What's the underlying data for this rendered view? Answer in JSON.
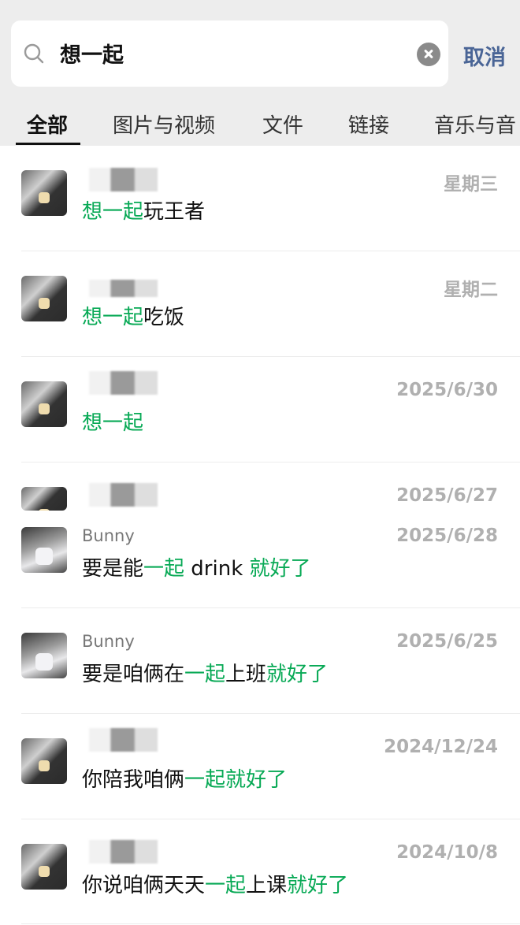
{
  "search": {
    "query": "想一起",
    "cancel_label": "取消"
  },
  "tabs": [
    {
      "label": "全部"
    },
    {
      "label": "图片与视频"
    },
    {
      "label": "文件"
    },
    {
      "label": "链接"
    },
    {
      "label": "音乐与音"
    }
  ],
  "colors": {
    "highlight": "#07a955",
    "cancel": "#4a6596",
    "date": "#b0b0b0"
  },
  "results": [
    {
      "date": "星期三",
      "parts": [
        "想一起",
        "玩王者"
      ]
    },
    {
      "date": "星期二",
      "parts": [
        "想一起",
        "吃饭"
      ]
    },
    {
      "date": "2025/6/30",
      "parts": [
        "想一起"
      ]
    },
    {
      "date": "2025/6/27"
    },
    {
      "name": "Bunny",
      "date": "2025/6/28",
      "parts": [
        "要是能",
        "一起",
        " drink ",
        "就好了"
      ]
    },
    {
      "name": "Bunny",
      "date": "2025/6/25",
      "parts": [
        "要是咱俩在",
        "一起",
        "上班",
        "就好了"
      ]
    },
    {
      "date": "2024/12/24",
      "parts": [
        "你陪我咱俩",
        "一起",
        "就好了"
      ]
    },
    {
      "date": "2024/10/8",
      "parts": [
        "你说咱俩天天",
        "一起",
        "上课",
        "就好了"
      ]
    }
  ]
}
